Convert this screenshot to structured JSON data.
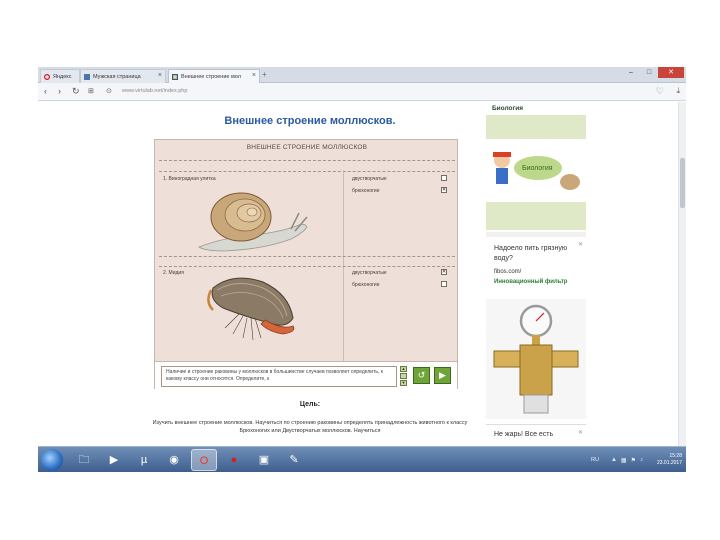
{
  "browser": {
    "tabs": [
      {
        "label": "Яндекс",
        "icon": "opera-icon"
      },
      {
        "label": "Мужская страница",
        "icon": "vk-icon"
      },
      {
        "label": "Внешнее строение мол",
        "icon": "page-icon"
      }
    ],
    "url": "www.virtulab.net/index.php",
    "window_controls": [
      "‒",
      "□",
      "✕"
    ]
  },
  "page": {
    "title": "Внешнее строение моллюсков.",
    "simulation": {
      "title": "ВНЕШНЕЕ СТРОЕНИЕ МОЛЛЮСКОВ",
      "rows": [
        {
          "label": "1.  Виноградная улитка",
          "options": [
            {
              "label": "двустворчатые",
              "checked": false
            },
            {
              "label": "брюхоногие",
              "checked": true
            }
          ]
        },
        {
          "label": "2.  Мидия",
          "options": [
            {
              "label": "двустворчатые",
              "checked": true
            },
            {
              "label": "брюхоногие",
              "checked": false
            }
          ]
        }
      ],
      "info_text": "Наличие и строение раковины у моллюсков в большинстве случаев позволяет определить, к какому классу они относятся. Определите, к"
    },
    "goal_heading": "Цель:",
    "goal_text": "Изучить внешнее строение моллюсков. Научиться по строению раковины определять принадлежность животного к классу Брюхоногих или Двустворчатых моллюсков. Научиться"
  },
  "ads": {
    "ad1_title": "Биология",
    "ad2_title": "Надоело пить грязную воду?",
    "ad2_site": "fibos.com/",
    "ad2_sub": "Инновационный фильтр",
    "ad3_title": "Не жарь! Все есть"
  },
  "taskbar": {
    "language": "RU",
    "time": "15:28",
    "date": "23.01.2017"
  },
  "colors": {
    "title_blue": "#2b5aa0",
    "sim_bg": "#eee0d8",
    "control_green": "#6ea438",
    "taskbar": "#4a6a98"
  }
}
